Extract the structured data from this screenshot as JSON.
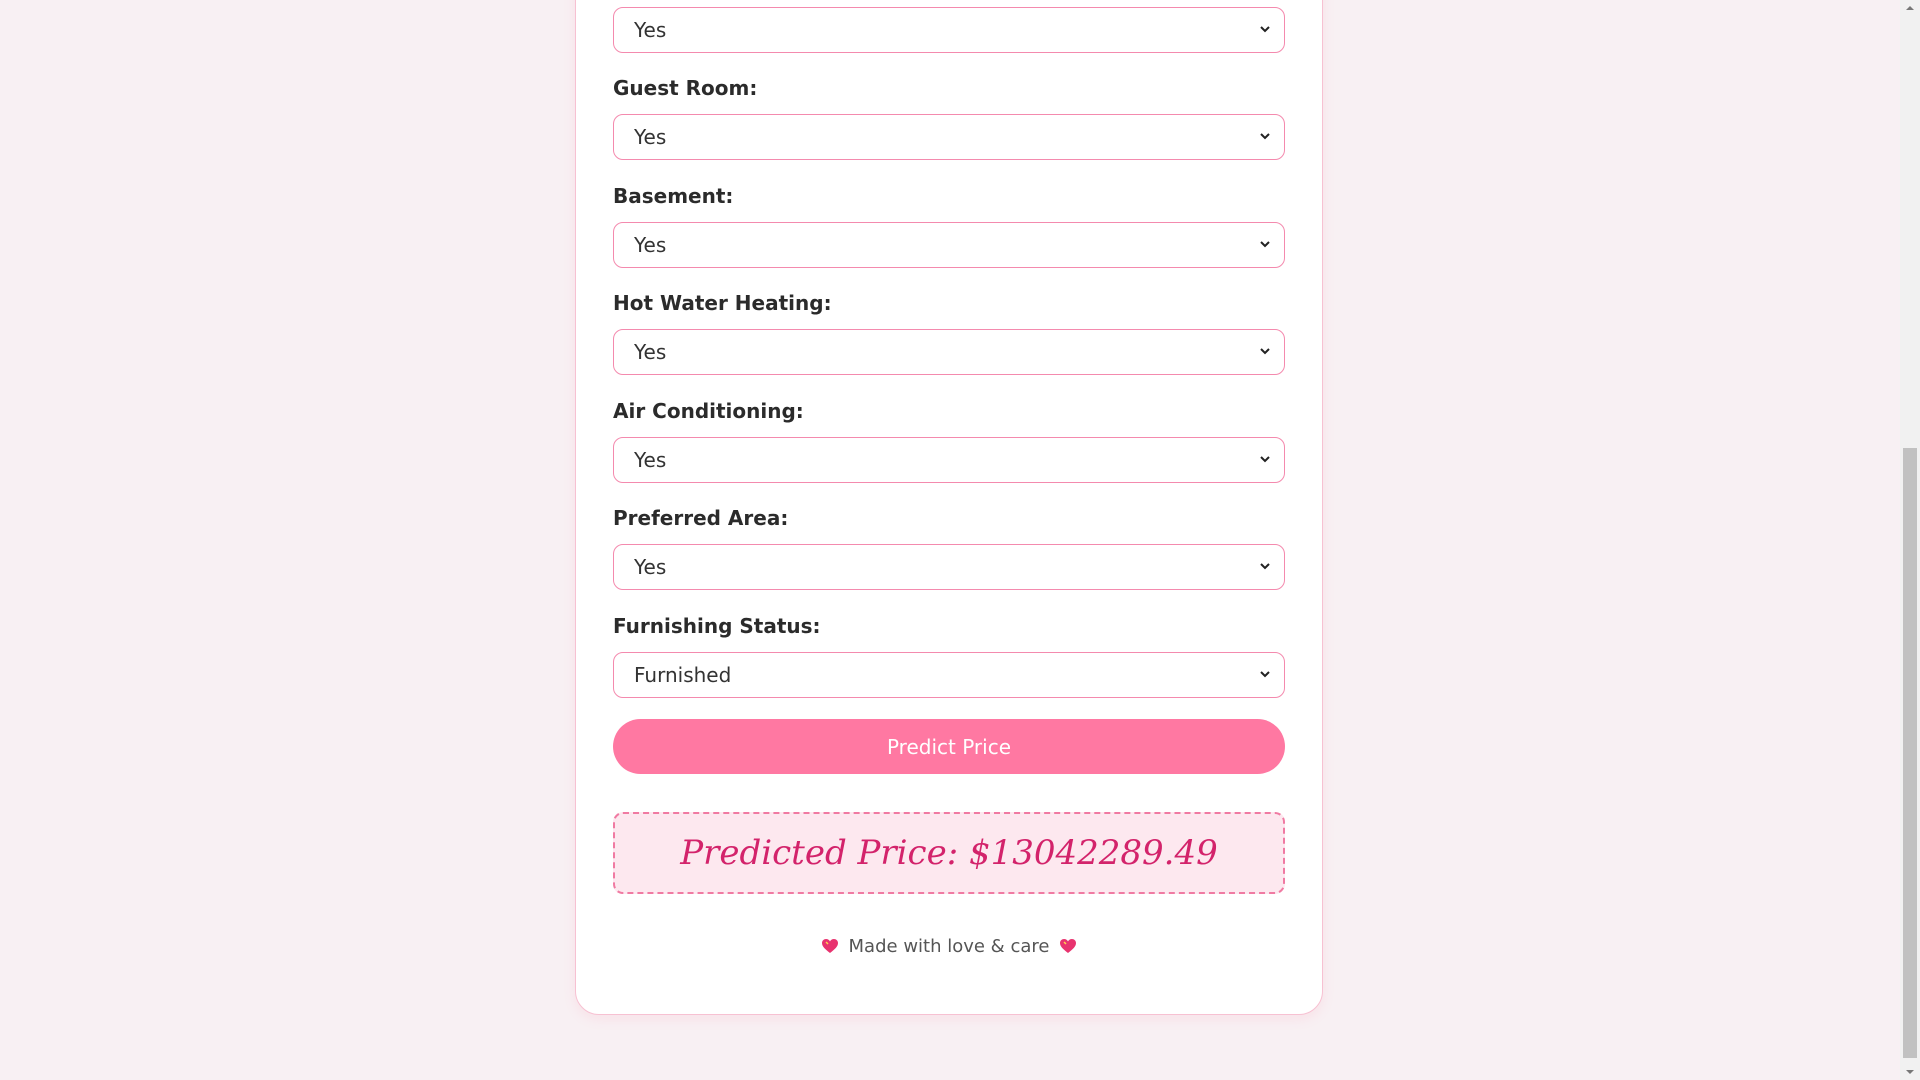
{
  "form": {
    "fields": [
      {
        "label": "",
        "value": "Yes"
      },
      {
        "label": "Guest Room:",
        "value": "Yes"
      },
      {
        "label": "Basement:",
        "value": "Yes"
      },
      {
        "label": "Hot Water Heating:",
        "value": "Yes"
      },
      {
        "label": "Air Conditioning:",
        "value": "Yes"
      },
      {
        "label": "Preferred Area:",
        "value": "Yes"
      },
      {
        "label": "Furnishing Status:",
        "value": "Furnished"
      }
    ],
    "predict_label": "Predict Price"
  },
  "result": {
    "text": "Predicted Price: $13042289.49"
  },
  "footer": {
    "text": "Made with love & care"
  },
  "colors": {
    "accent": "#ff78a2",
    "border": "#f48aae",
    "result_text": "#d3236b",
    "background": "#f8f0f3"
  },
  "icons": {
    "select_arrow": "chevron-down-icon",
    "footer_decoration": "heart-icon"
  }
}
